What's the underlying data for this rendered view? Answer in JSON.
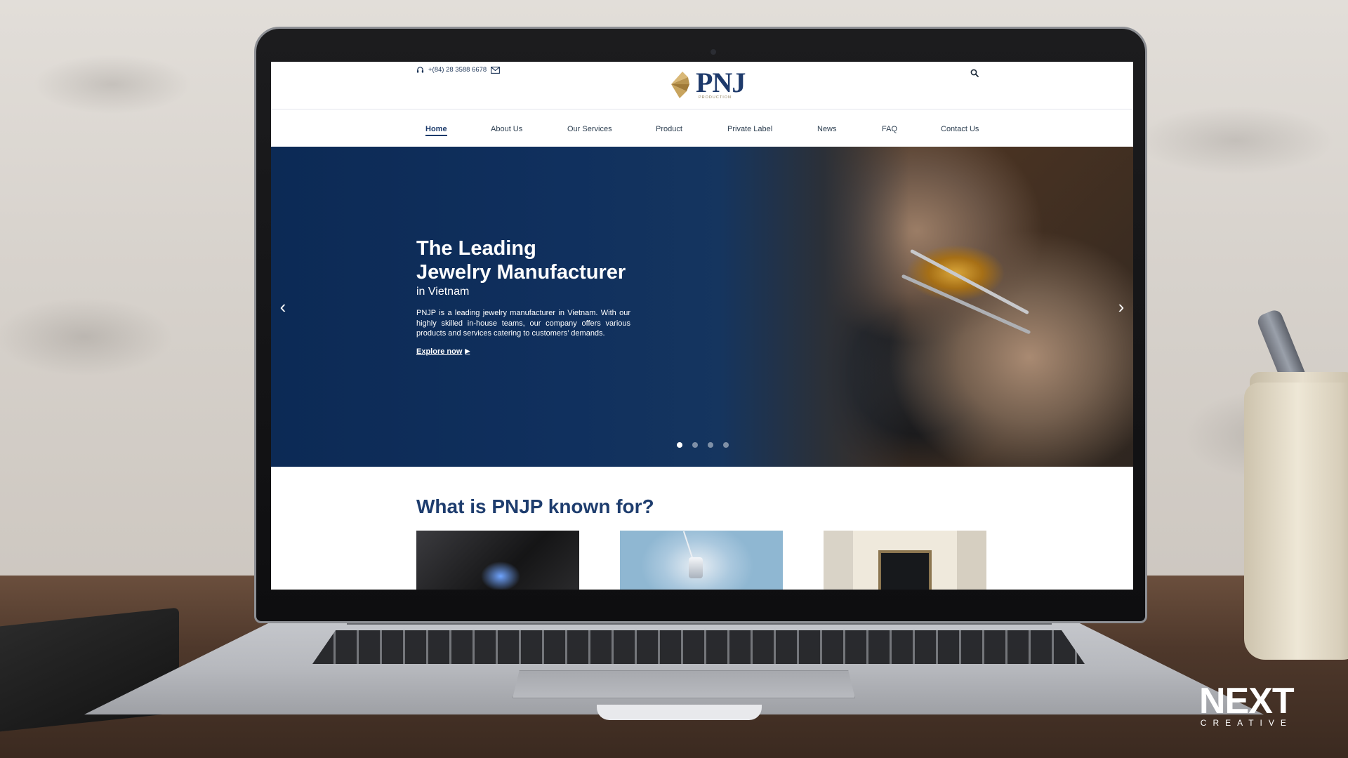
{
  "header": {
    "phone": "+(84) 28 3588 6678",
    "logo_text": "PNJ",
    "logo_sub": "PRODUCTION"
  },
  "nav": {
    "items": [
      {
        "label": "Home",
        "active": true
      },
      {
        "label": "About Us"
      },
      {
        "label": "Our Services"
      },
      {
        "label": "Product"
      },
      {
        "label": "Private Label"
      },
      {
        "label": "News"
      },
      {
        "label": "FAQ"
      },
      {
        "label": "Contact Us"
      }
    ]
  },
  "hero": {
    "title_line1": "The Leading",
    "title_line2": "Jewelry Manufacturer",
    "subtitle": "in Vietnam",
    "description": "PNJP is a leading jewelry manufacturer in Vietnam. With our highly skilled in-house teams, our company offers various products and services catering to customers’ demands.",
    "cta": "Explore now",
    "prev_arrow": "‹",
    "next_arrow": "›",
    "slide_count": 4,
    "active_slide": 1
  },
  "section": {
    "title": "What is PNJP known for?"
  },
  "watermark": {
    "main": "NEXT",
    "sub": "CREATIVE"
  },
  "colors": {
    "brand_navy": "#1e3d6e",
    "hero_blue": "#0c2a55",
    "logo_gold": "#c9a45c"
  },
  "icons": {
    "phone": "headset-icon",
    "mail": "mail-icon",
    "search": "search-icon"
  }
}
